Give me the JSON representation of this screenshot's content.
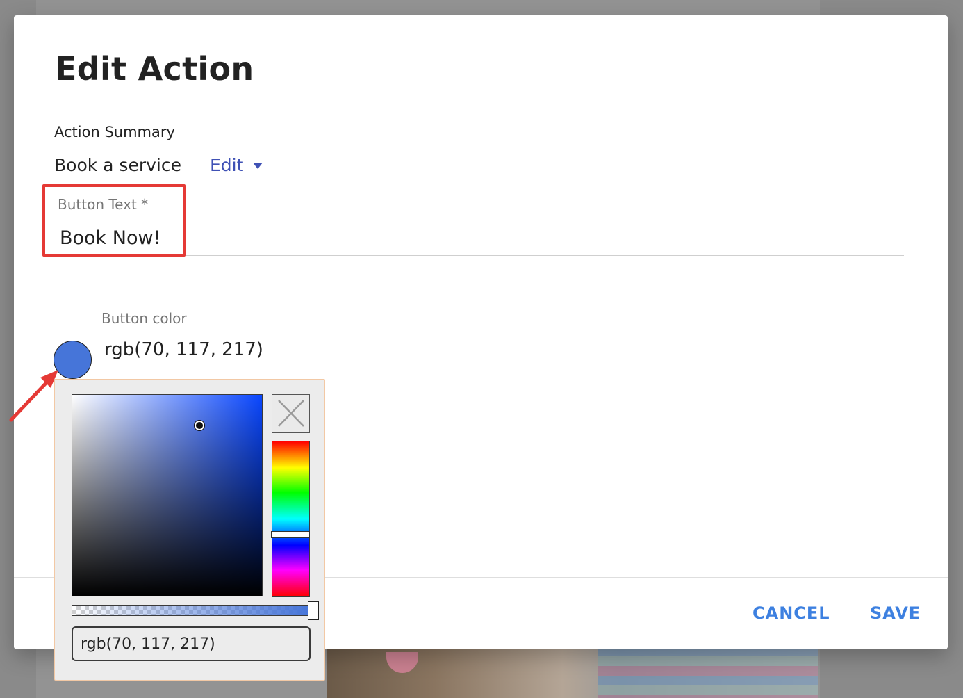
{
  "dialog": {
    "title": "Edit Action",
    "summary_label": "Action Summary",
    "summary_value": "Book a service",
    "edit_link": "Edit",
    "button_text": {
      "label": "Button Text *",
      "value": "Book Now!"
    },
    "button_color": {
      "label": "Button color",
      "value": "rgb(70, 117, 217)",
      "swatch": "#4675d9"
    },
    "actions": {
      "cancel": "CANCEL",
      "save": "SAVE"
    }
  },
  "color_picker": {
    "value": "rgb(70, 117, 217)",
    "icons": {
      "clear": "close-icon"
    }
  },
  "annotations": {
    "highlight_color": "#e53935"
  }
}
